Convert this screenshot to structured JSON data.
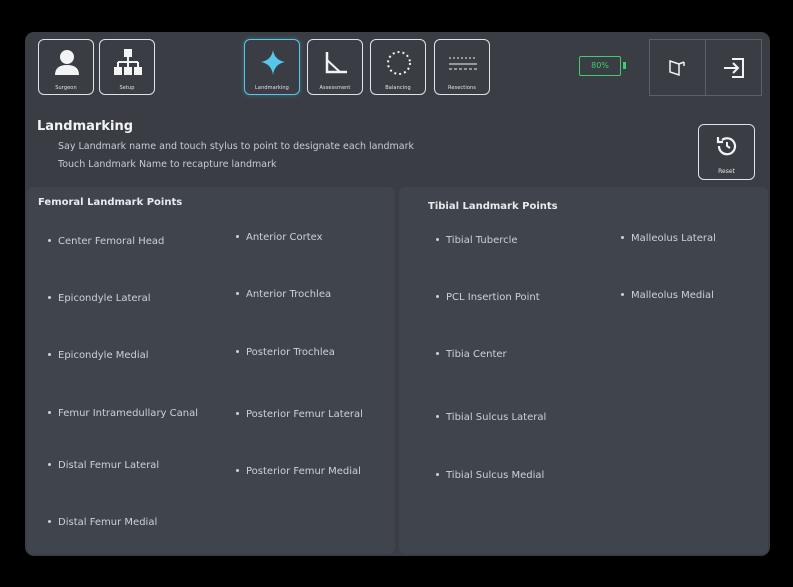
{
  "toolbar": {
    "left_buttons": [
      {
        "label": "Surgeon",
        "icon": "user-icon"
      },
      {
        "label": "Setup",
        "icon": "hierarchy-icon"
      }
    ],
    "workflow_buttons": [
      {
        "label": "Landmarking",
        "icon": "sparkle-icon",
        "active": true
      },
      {
        "label": "Assessment",
        "icon": "angle-icon",
        "active": false
      },
      {
        "label": "Balancing",
        "icon": "dotted-circle-icon",
        "active": false
      },
      {
        "label": "Resections",
        "icon": "resection-lines-icon",
        "active": false
      }
    ],
    "battery": {
      "level": 0.8,
      "label": "80%"
    },
    "right_buttons": [
      {
        "icon": "view-icon"
      },
      {
        "icon": "logout-icon"
      }
    ]
  },
  "header": {
    "title": "Landmarking",
    "instruction_1": "Say Landmark name and touch stylus to point to designate each landmark",
    "instruction_2": "Touch Landmark Name to recapture landmark",
    "reset_label": "Reset"
  },
  "femoral": {
    "title": "Femoral Landmark Points",
    "points": [
      "Center Femoral Head",
      "Epicondyle Lateral",
      "Epicondyle Medial",
      "Femur Intramedullary Canal",
      "Distal Femur Lateral",
      "Distal Femur Medial",
      "Anterior Cortex",
      "Anterior Trochlea",
      "Posterior Trochlea",
      "Posterior Femur Lateral",
      "Posterior Femur Medial"
    ]
  },
  "tibial": {
    "title": "Tibial Landmark Points",
    "points": [
      "Tibial Tubercle",
      "PCL Insertion Point",
      "Tibia Center",
      "Tibial Sulcus Lateral",
      "Tibial Sulcus Medial",
      "Malleolus Lateral",
      "Malleolus Medial"
    ]
  },
  "colors": {
    "background": "#000000",
    "app": "#3a3d44",
    "panel": "#40444c",
    "accent_active": "#58c6ea",
    "battery": "#3fce6e"
  }
}
